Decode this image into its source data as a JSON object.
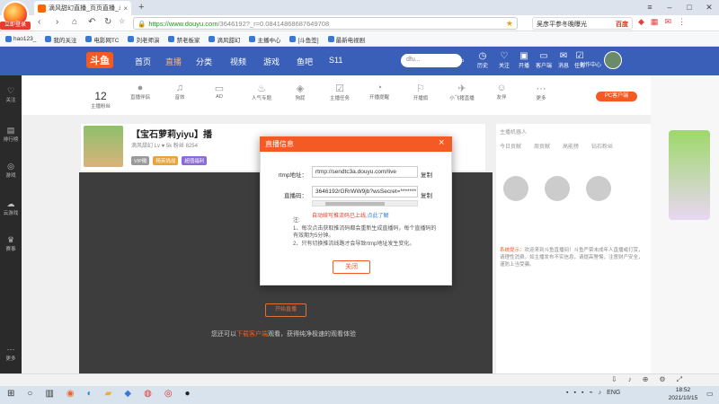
{
  "browser": {
    "tab_title": "滴风甜幻直播_页页直播_斗鱼...",
    "url_https": "https://www.douyu.com",
    "url_rest": "/3646192?_r=0.08414868687649708",
    "search_placeholder": "吴彦平参冬晚曝光",
    "search_engine": "百度",
    "logo_tag": "立即登录"
  },
  "bookmarks": [
    "hao123_",
    "我的关注",
    "电影网TC",
    "刘老师演",
    "禁老板家",
    "滴风甜幻",
    "主播中心",
    "[斗鱼签]",
    "最新电视剧"
  ],
  "site": {
    "logo": "斗鱼",
    "nav": [
      "首页",
      "直播",
      "分类",
      "视频",
      "游戏",
      "鱼吧",
      "S11"
    ],
    "search_placeholder": "dfu...",
    "header_icons": [
      "历史",
      "关注",
      "开播",
      "客户端",
      "消息",
      "任务",
      "创作中心"
    ]
  },
  "left_sidebar": [
    "关注",
    "排行榜",
    "游戏",
    "云游戏",
    "赛事",
    "更多"
  ],
  "tools": {
    "count": "12",
    "count_label": "主播粉丝",
    "items": [
      "直播伴侣",
      "音效",
      "AD",
      "人气专题",
      "狗屁",
      "主播任务",
      "开播提醒",
      "开播旗",
      "小飞猪直播",
      "友伴",
      "更多"
    ],
    "pc_button": "PC客户端"
  },
  "streamer": {
    "room_title": "【宝石萝莉yiyu】播",
    "meta": "滴风甜幻  Lv  ♥ 5k  粉丝  8254",
    "badges": [
      "VIP徽",
      "精英挑战",
      "超值福利"
    ]
  },
  "video": {
    "start_button": "开始直播",
    "tip_prefix": "您还可以",
    "tip_link": "下载客户端",
    "tip_suffix": "观看，获得纯净极速的观看体验"
  },
  "right_panel": {
    "host_label": "主播机器人",
    "tabs": [
      "今日贡献",
      "周贡献",
      "高能榜",
      "钻石粉丝"
    ],
    "notice_label": "系统提示：",
    "notice": "欢迎来到斗鱼直播间！斗鱼严禁未成年人直播或打赏，请理性消费。如主播发布不实信息，请提高警惕，注意财产安全，谨防上当受骗。"
  },
  "modal": {
    "title": "直播信息",
    "close_icon": "×",
    "rtmp_label": "rtmp地址：",
    "rtmp_value": "rtmp://sendtc3a.douyu.com/live",
    "code_label": "直播码：",
    "code_value": "3646192rGRrWW9jb?wsSecret=*******",
    "copy": "复制",
    "warn": "自动续写推流码已上线,",
    "warn_link": "点此了解",
    "notes_title": "注:",
    "note1": "1、每次点击获取推流码都会重新生成直播码，每个直播码的有效期为5分钟。",
    "note2": "2、只有切换推流线路才会导致rtmp地址发生变化。",
    "close_button": "关闭"
  },
  "taskbar": {
    "lang": "ENG",
    "time": "18:52",
    "date": "2021/10/15"
  }
}
